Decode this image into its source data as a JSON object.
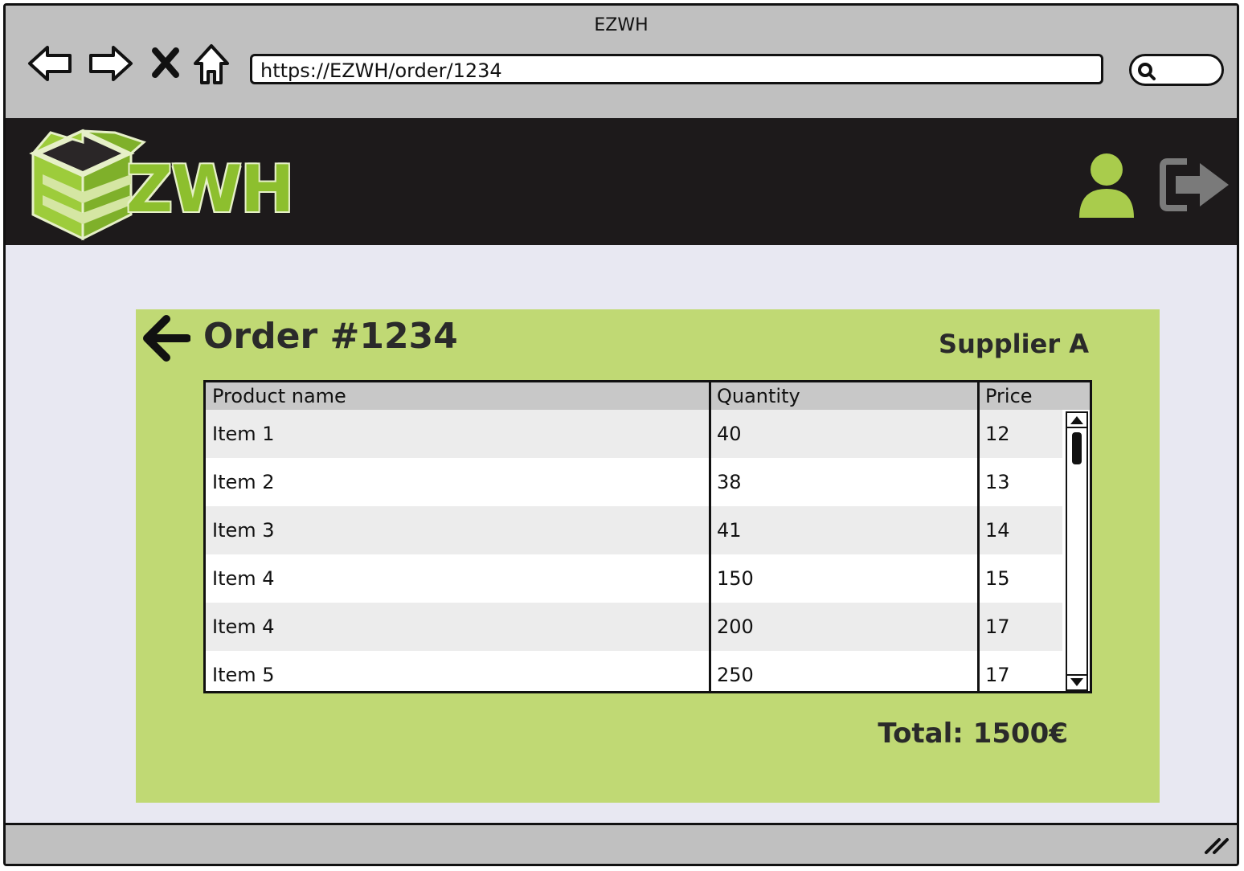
{
  "window": {
    "title": "EZWH"
  },
  "browser": {
    "url": "https://EZWH/order/1234"
  },
  "app": {
    "logo_text": "ZWH"
  },
  "order": {
    "title": "Order #1234",
    "supplier": "Supplier A",
    "total": "Total: 1500€"
  },
  "table": {
    "headers": [
      "Product name",
      "Quantity",
      "Price"
    ],
    "rows": [
      [
        "Item 1",
        "40",
        "12"
      ],
      [
        "Item 2",
        "38",
        "13"
      ],
      [
        "Item 3",
        "41",
        "14"
      ],
      [
        "Item 4",
        "150",
        "15"
      ],
      [
        "Item 4",
        "200",
        "17"
      ],
      [
        "Item 5",
        "250",
        "17"
      ]
    ]
  },
  "colors": {
    "accent": "#c0d974",
    "brand_green": "#8dbf2e",
    "appbar": "#1d1a1b"
  },
  "icons": [
    "back-nav-icon",
    "forward-nav-icon",
    "stop-icon",
    "home-icon",
    "search-icon",
    "user-icon",
    "logout-icon",
    "back-arrow-icon",
    "resize-grip-icon"
  ]
}
